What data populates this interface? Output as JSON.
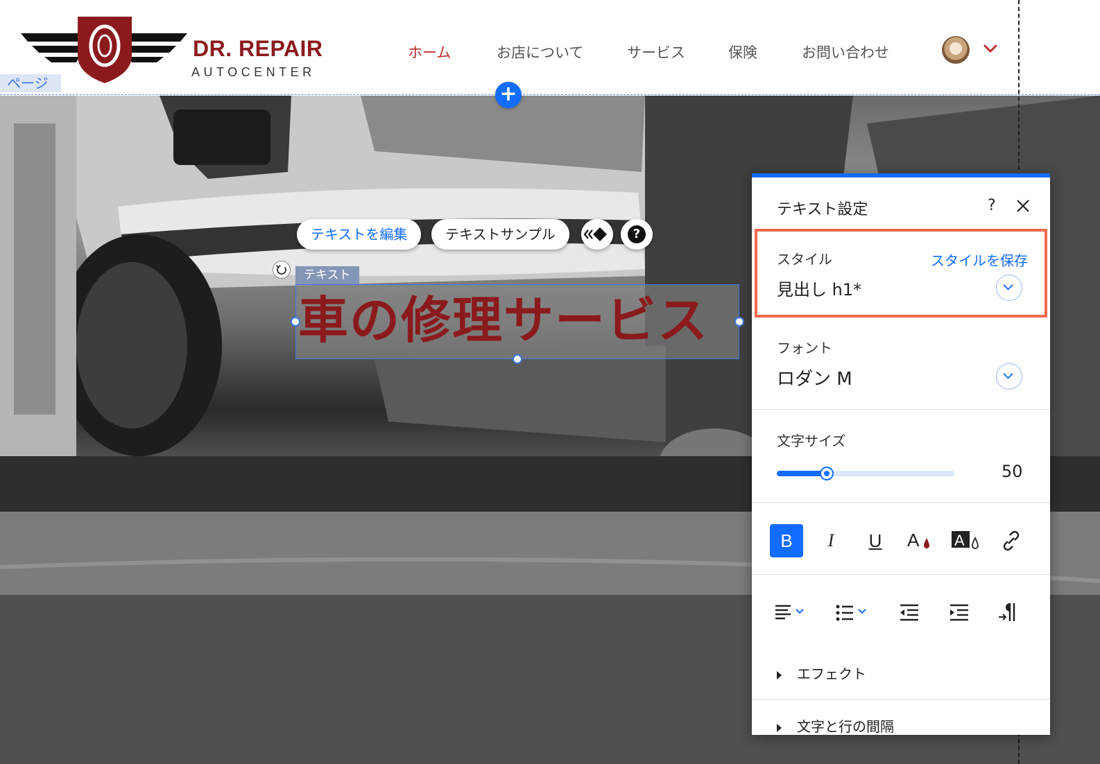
{
  "site": {
    "brand_name": "DR. REPAIR",
    "brand_sub": "AUTOCENTER",
    "nav": [
      {
        "label": "ホーム",
        "active": true
      },
      {
        "label": "お店について",
        "active": false
      },
      {
        "label": "サービス",
        "active": false
      },
      {
        "label": "保険",
        "active": false
      },
      {
        "label": "お問い合わせ",
        "active": false
      }
    ],
    "brand_color": "#8b1a1d"
  },
  "editor": {
    "page_tag": "ページ",
    "add_button": "+",
    "toolbar": {
      "edit_text": "テキストを編集",
      "text_sample": "テキストサンプル",
      "help": "?"
    },
    "element_tag": "テキスト",
    "heading": "車の修理サービス",
    "accent": "#116dff",
    "highlight": "#f26b4f"
  },
  "panel": {
    "title": "テキスト設定",
    "help": "?",
    "style": {
      "label": "スタイル",
      "save_link": "スタイルを保存",
      "value": "見出し h1*"
    },
    "font": {
      "label": "フォント",
      "value": "ロダン M"
    },
    "size": {
      "label": "文字サイズ",
      "value": "50",
      "slider_fraction": 0.28
    },
    "format": {
      "bold": "B",
      "italic": "I",
      "underline": "U"
    },
    "effects": "エフェクト",
    "spacing": "文字と行の間隔"
  }
}
